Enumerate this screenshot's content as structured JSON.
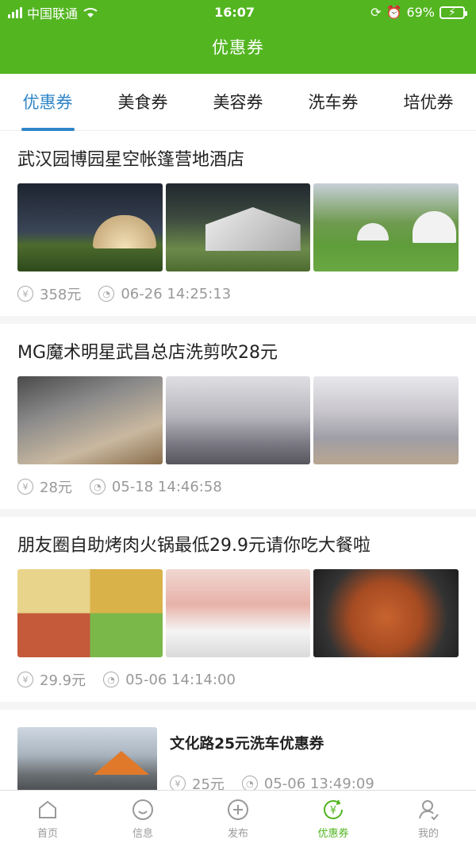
{
  "status": {
    "carrier": "中国联通",
    "time": "16:07",
    "battery": "69%"
  },
  "header": {
    "title": "优惠券"
  },
  "tabs": [
    {
      "label": "优惠券",
      "active": true
    },
    {
      "label": "美食券"
    },
    {
      "label": "美容券"
    },
    {
      "label": "洗车券"
    },
    {
      "label": "培优券"
    }
  ],
  "items": [
    {
      "title": "武汉园博园星空帐篷营地酒店",
      "price": "358元",
      "time": "06-26 14:25:13"
    },
    {
      "title": "MG魔术明星武昌总店洗剪吹28元",
      "price": "28元",
      "time": "05-18 14:46:58"
    },
    {
      "title": "朋友圈自助烤肉火锅最低29.9元请你吃大餐啦",
      "price": "29.9元",
      "time": "05-06 14:14:00"
    },
    {
      "title": "文化路25元洗车优惠券",
      "price": "25元",
      "time": "05-06 13:49:09"
    }
  ],
  "nav": [
    {
      "label": "首页"
    },
    {
      "label": "信息"
    },
    {
      "label": "发布"
    },
    {
      "label": "优惠券",
      "active": true
    },
    {
      "label": "我的"
    }
  ],
  "colors": {
    "brand": "#53b520",
    "tab_active": "#2f86c9"
  }
}
